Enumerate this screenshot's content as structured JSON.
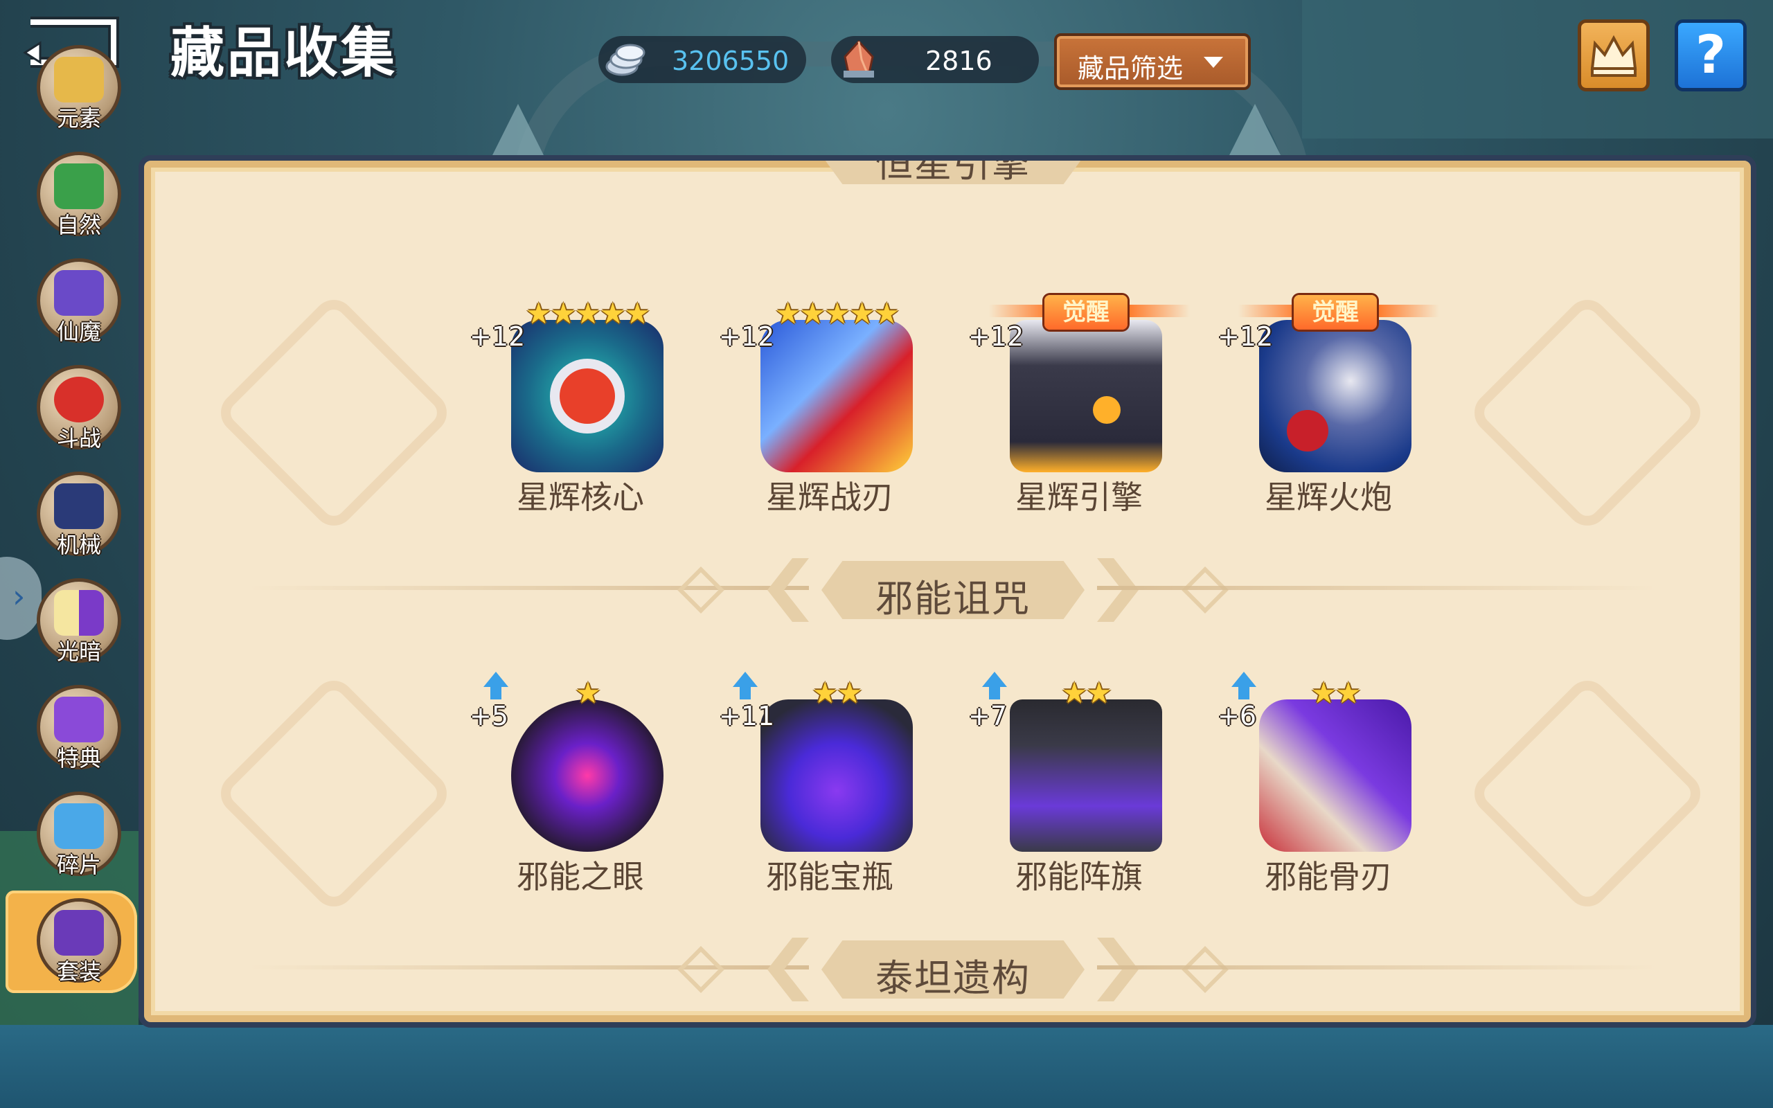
{
  "header": {
    "title": "藏品收集",
    "filter_label": "藏品筛选",
    "help_label": "?"
  },
  "currencies": [
    {
      "icon": "silver-coins-icon",
      "value": "3206550",
      "color": "#59c2f0"
    },
    {
      "icon": "gem-shard-icon",
      "value": "2816",
      "color": "#ffffff"
    }
  ],
  "sidebar": {
    "items": [
      {
        "label": "元素",
        "icon": "element-icon",
        "color": "#e6b84a"
      },
      {
        "label": "自然",
        "icon": "tree-icon",
        "color": "#3aa04a"
      },
      {
        "label": "仙魔",
        "icon": "immortal-demon-icon",
        "color": "#6a4ac8"
      },
      {
        "label": "斗战",
        "icon": "battle-orb-icon",
        "color": "#d8302a"
      },
      {
        "label": "机械",
        "icon": "mech-icon",
        "color": "#2a3a78"
      },
      {
        "label": "光暗",
        "icon": "light-dark-icon",
        "color": "#7a3ac8"
      },
      {
        "label": "特典",
        "icon": "special-box-icon",
        "color": "#8a4ad8"
      },
      {
        "label": "碎片",
        "icon": "shard-bottle-icon",
        "color": "#4aa8e8"
      },
      {
        "label": "套装",
        "icon": "set-gem-icon",
        "color": "#6a3ab8",
        "active": true
      }
    ]
  },
  "sections": [
    {
      "title": "恒星引擎",
      "partially_visible": true
    },
    {
      "title": "",
      "items": [
        {
          "name": "星辉核心",
          "level": "+12",
          "stars": "★★★★★",
          "awakened": false,
          "palette": [
            "#27c7b8",
            "#1a2a6a",
            "#e8402a"
          ]
        },
        {
          "name": "星辉战刃",
          "level": "+12",
          "stars": "★★★★★",
          "awakened": false,
          "palette": [
            "#d8202a",
            "#2a58d8",
            "#ffd23a"
          ]
        },
        {
          "name": "星辉引擎",
          "level": "+12",
          "stars": "",
          "awakened": true,
          "awaken_label": "觉醒",
          "palette": [
            "#2a2a3a",
            "#e8e8f0",
            "#ffb02a"
          ]
        },
        {
          "name": "星辉火炮",
          "level": "+12",
          "stars": "",
          "awakened": true,
          "awaken_label": "觉醒",
          "palette": [
            "#1a3a8a",
            "#e8e8f0",
            "#c8202a"
          ]
        }
      ]
    },
    {
      "title": "邪能诅咒",
      "items": [
        {
          "name": "邪能之眼",
          "level": "+5",
          "stars": "★",
          "upgradable": true,
          "palette": [
            "#6a20c8",
            "#2a1a3a",
            "#ff3aa8"
          ]
        },
        {
          "name": "邪能宝瓶",
          "level": "+11",
          "stars": "★★",
          "upgradable": true,
          "palette": [
            "#4a2ad8",
            "#2a2a3a",
            "#8a3af0"
          ]
        },
        {
          "name": "邪能阵旗",
          "level": "+7",
          "stars": "★★",
          "upgradable": true,
          "palette": [
            "#3a3a48",
            "#6a3ad8",
            "#2a2a30"
          ]
        },
        {
          "name": "邪能骨刃",
          "level": "+6",
          "stars": "★★",
          "upgradable": true,
          "palette": [
            "#7a3ae0",
            "#c8303a",
            "#e8d8c8"
          ]
        }
      ]
    },
    {
      "title": "泰坦遗构",
      "items": []
    }
  ]
}
